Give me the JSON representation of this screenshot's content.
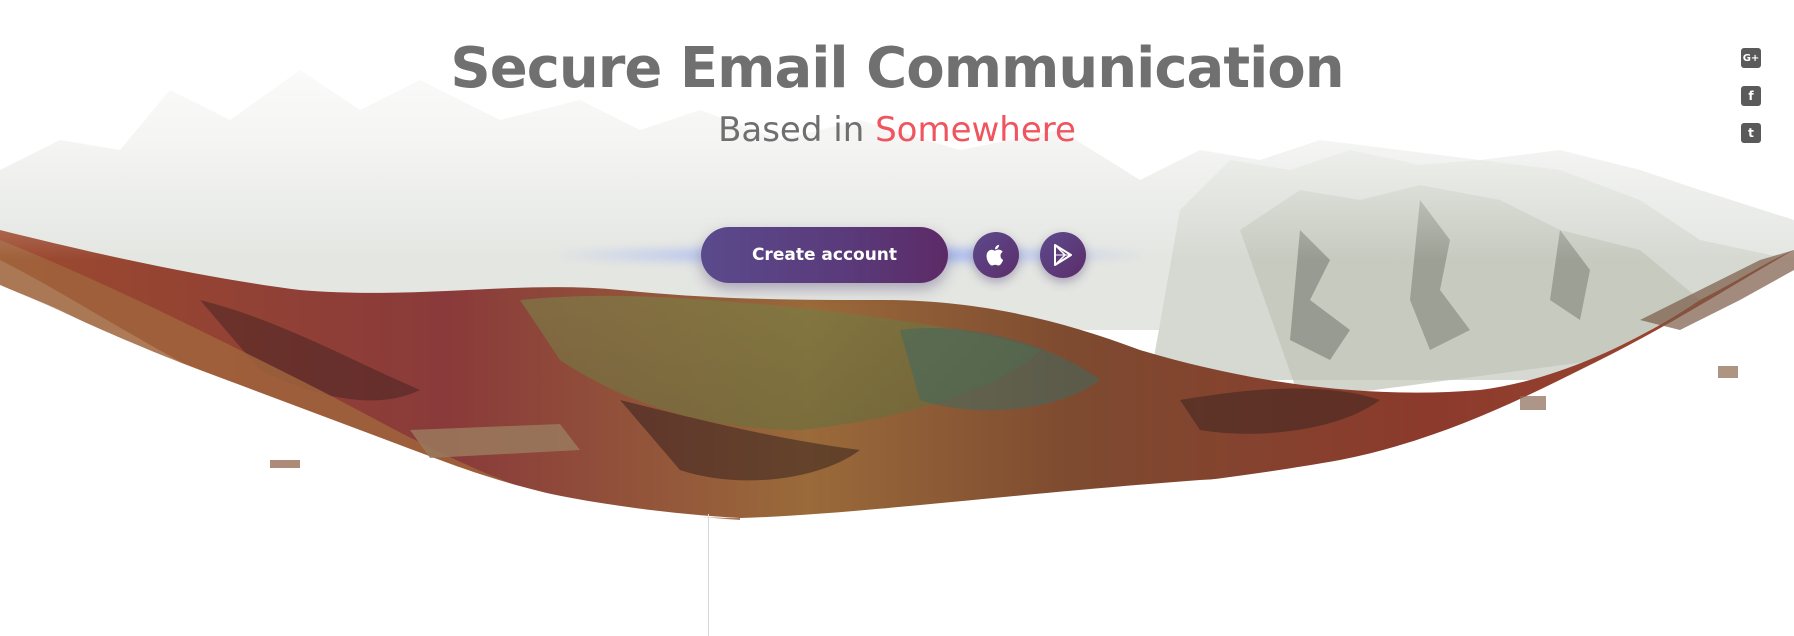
{
  "hero": {
    "title": "Secure Email Communication",
    "subtitle_prefix": "Based in",
    "subtitle_accent": "Somewhere",
    "cta_label": "Create account",
    "accent_color": "#f0545e",
    "button_color": "#5a3a7a"
  },
  "store_buttons": [
    {
      "icon": "apple-icon"
    },
    {
      "icon": "google-play-icon"
    }
  ],
  "social": [
    {
      "icon": "google-plus-icon",
      "glyph": "G+"
    },
    {
      "icon": "facebook-icon",
      "glyph": "f"
    },
    {
      "icon": "twitter-icon",
      "glyph": "t"
    }
  ]
}
